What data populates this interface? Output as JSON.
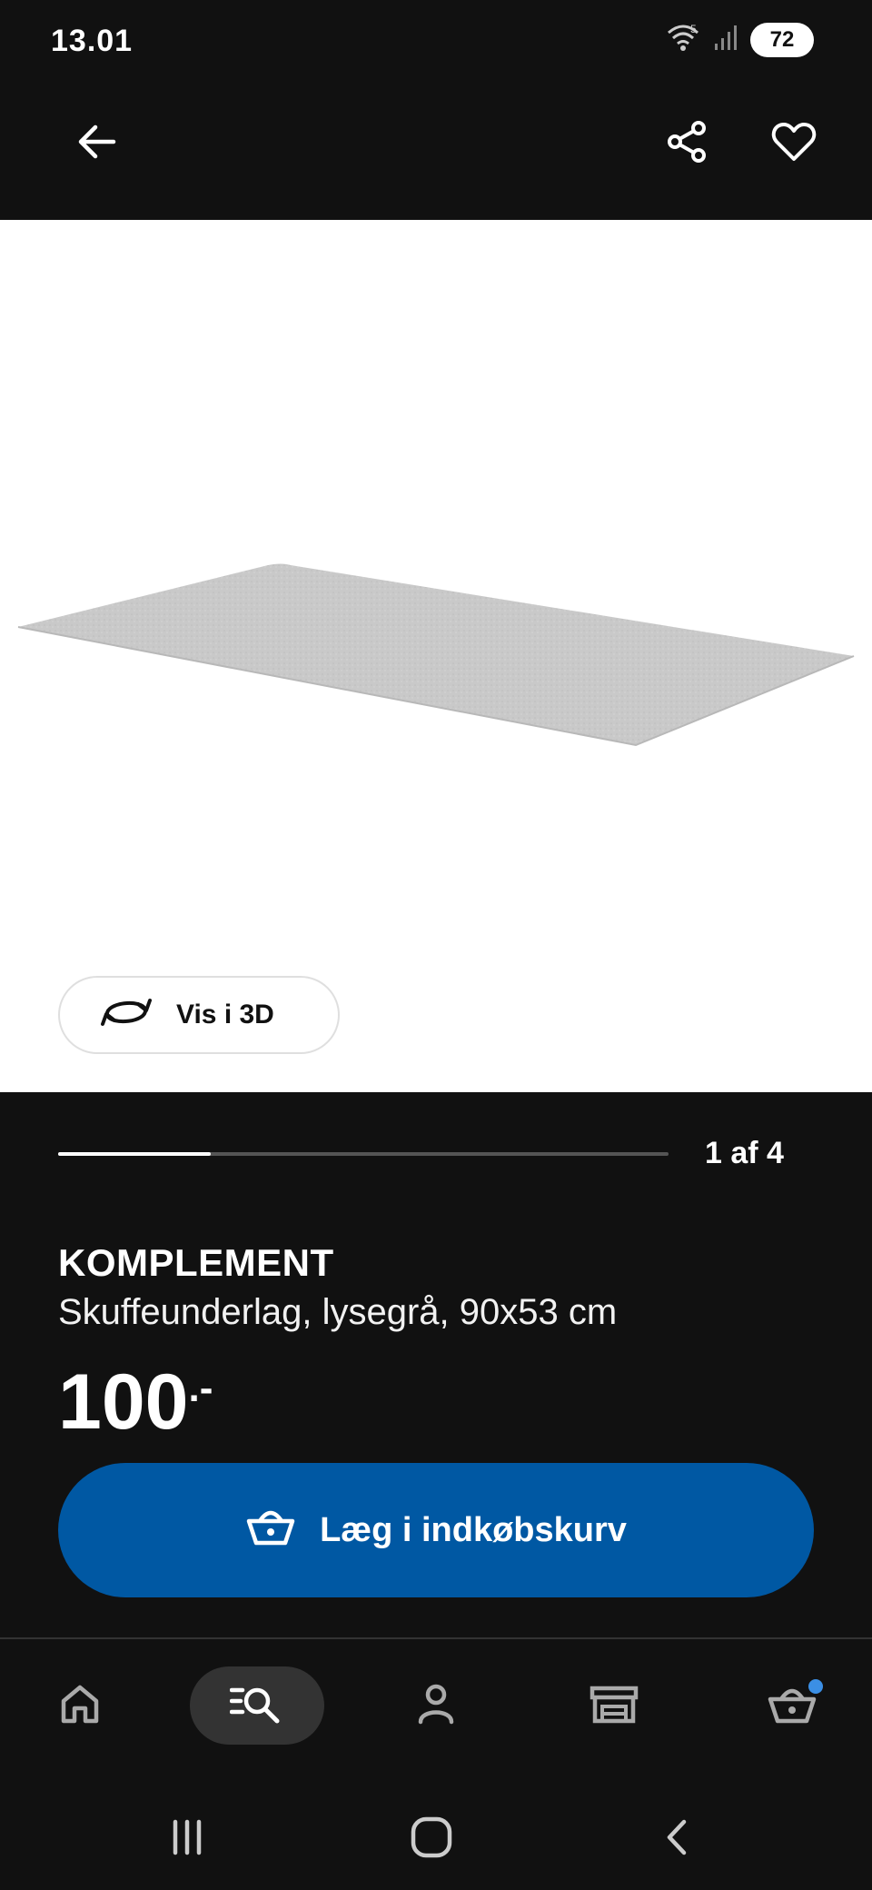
{
  "status_bar": {
    "time": "13.01",
    "battery": "72",
    "signal_label": "5"
  },
  "header": {
    "back_icon": "back-arrow-icon",
    "share_icon": "share-icon",
    "favorite_icon": "heart-icon"
  },
  "hero": {
    "view_3d_label": "Vis i 3D",
    "view_3d_icon": "rotate-3d-icon"
  },
  "gallery": {
    "counter": "1 af 4",
    "progress": 0.25
  },
  "product": {
    "name": "KOMPLEMENT",
    "description": "Skuffeunderlag, lysegrå, 90x53 cm",
    "price": "100",
    "price_suffix": ".-"
  },
  "cart_button": {
    "label": "Læg i indkøbskurv",
    "icon": "basket-icon",
    "color": "#0058a3"
  },
  "bottom_nav": {
    "items": [
      {
        "id": "home",
        "icon": "home-icon"
      },
      {
        "id": "search",
        "icon": "search-list-icon",
        "active": true
      },
      {
        "id": "profile",
        "icon": "person-icon"
      },
      {
        "id": "store",
        "icon": "store-icon"
      },
      {
        "id": "cart",
        "icon": "basket-icon",
        "badge": true
      }
    ]
  },
  "system_nav": {
    "recent_icon": "recent-apps-icon",
    "home_icon": "home-circle-icon",
    "back_icon": "back-chevron-icon"
  }
}
